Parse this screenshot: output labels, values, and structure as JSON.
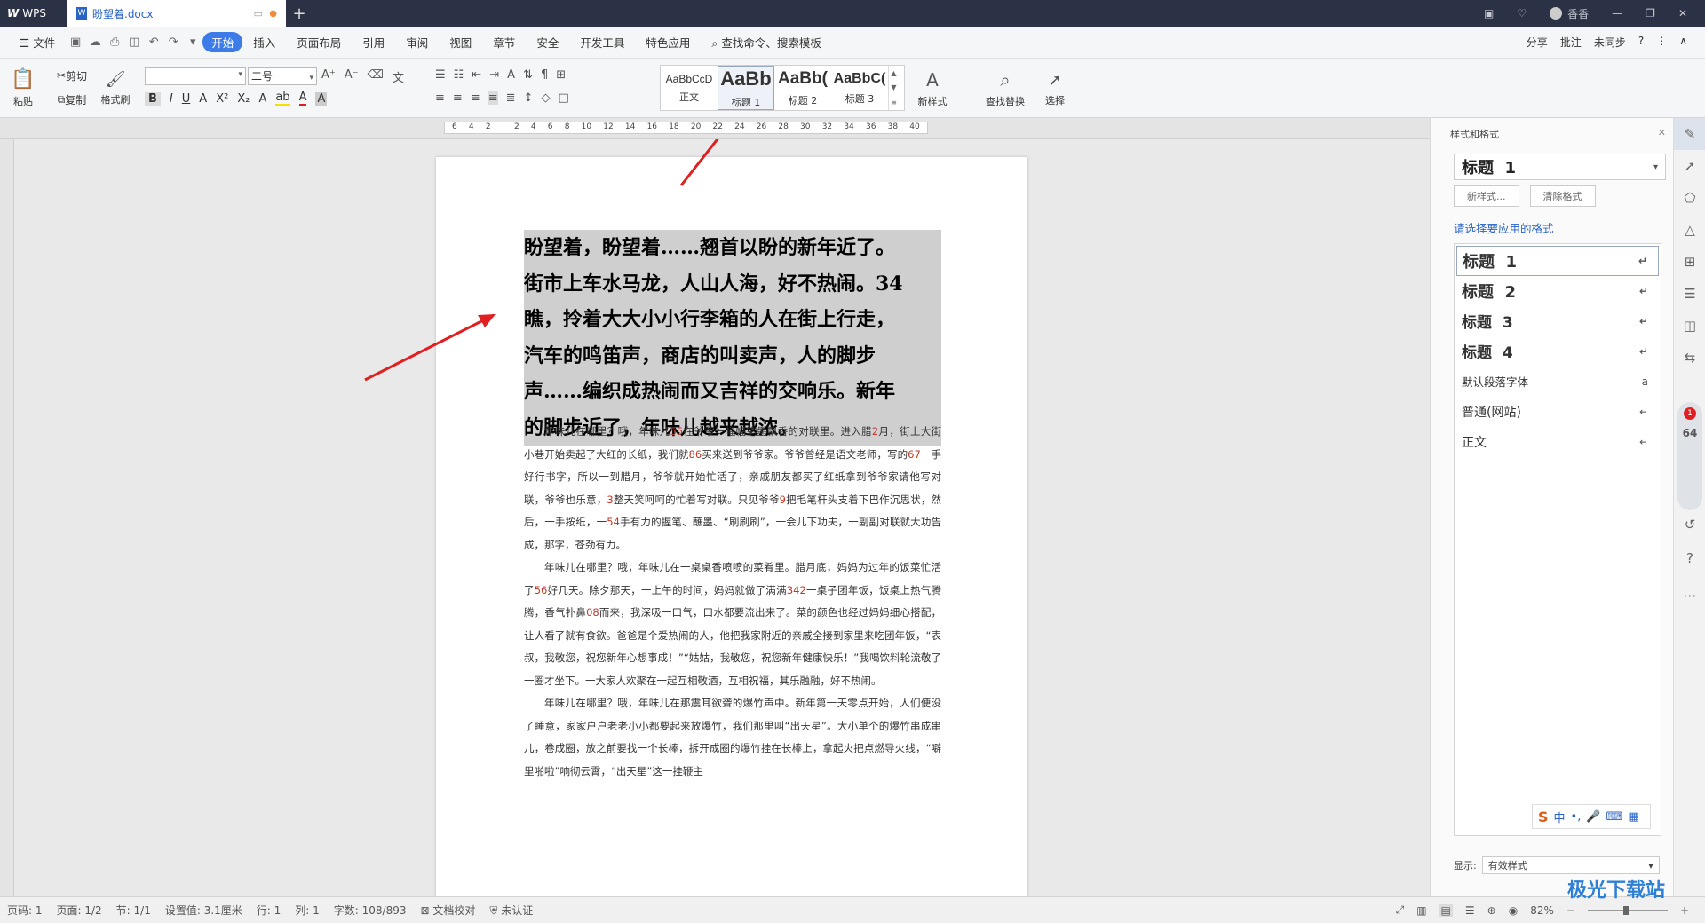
{
  "titlebar": {
    "app": "WPS",
    "doc_tab": "盼望着.docx",
    "user": "香香"
  },
  "menu": {
    "file": "文件",
    "items": [
      "开始",
      "插入",
      "页面布局",
      "引用",
      "审阅",
      "视图",
      "章节",
      "安全",
      "开发工具",
      "特色应用"
    ],
    "search": "查找命令、搜索模板",
    "right": [
      "分享",
      "批注",
      "未同步"
    ]
  },
  "ribbon": {
    "paste": "粘贴",
    "cut": "剪切",
    "copy": "复制",
    "format_painter": "格式刷",
    "font_name": "",
    "font_size": "二号",
    "styles": [
      {
        "preview": "AaBbCcD",
        "label": "正文"
      },
      {
        "preview": "AaBb",
        "label": "标题 1"
      },
      {
        "preview": "AaBb(",
        "label": "标题 2"
      },
      {
        "preview": "AaBbC(",
        "label": "标题 3"
      }
    ],
    "new_style": "新样式",
    "find_replace": "查找替换",
    "select": "选择"
  },
  "ruler": {
    "ticks": [
      "6",
      "4",
      "2",
      "",
      "2",
      "4",
      "6",
      "8",
      "10",
      "12",
      "14",
      "16",
      "18",
      "20",
      "22",
      "24",
      "26",
      "28",
      "30",
      "32",
      "34",
      "36",
      "38",
      "40"
    ]
  },
  "document": {
    "heading_lines": [
      "盼望着，盼望着……翘首以盼的新年近了。",
      "街市上车水马龙，人山人海，好不热闹。34",
      "瞧，拎着大大小小行李箱的人在街上行走，",
      "汽车的鸣笛声，商店的叫卖声，人的脚步",
      "声……编织成热闹而又吉祥的交响乐。新年",
      "的脚步近了，年味儿越来越浓。"
    ],
    "p1": {
      "a": "年味儿在哪里？哦，年味儿",
      "n1": "55",
      "b": "在爷爷一幅幅笔墨飘香的对联里。进入腊",
      "n2": "2",
      "c": "月，街上大街小巷开始卖起了大红的长纸，我们就",
      "n3": "86",
      "d": "买来送到爷爷家。爷爷曾经是语文老师，写的",
      "n4": "67",
      "e": "一手好行书字，所以一到腊月，爷爷就开始忙活了，亲戚朋友都买了红纸拿到爷爷家请他写对联，爷爷也乐意，",
      "n5": "3",
      "f": "整天笑呵呵的忙着写对联。只见爷爷",
      "n6": "9",
      "g": "把毛笔杆头支着下巴作沉思状，然后，一手按纸，一",
      "n7": "54",
      "h": "手有力的握笔、蘸墨、“刷刷刷”，一会儿下功夫，一副副对联就大功告成，那字，苍劲有力。"
    },
    "p2": {
      "a": "年味儿在哪里？哦，年味儿在一桌桌香喷喷的菜肴里。腊月底，妈妈为过年的饭菜忙活了",
      "n1": "56",
      "b": "好几天。除夕那天，一上午的时间，妈妈就做了满满",
      "n2": "342",
      "c": "一桌子团年饭，饭桌上热气腾腾，香气扑鼻",
      "n3": "08",
      "d": "而来，我深吸一口气，口水都要流出来了。菜的颜色也经过妈妈细心搭配，让人看了就有食欲。爸爸是个爱热闹的人，他把我家附近的亲戚全接到家里来吃团年饭，“表叔，我敬您，祝您新年心想事成！”“姑姑，我敬您，祝您新年健康快乐！”我喝饮料轮流敬了一圈才坐下。一大家人欢聚在一起互相敬酒，互相祝福，其乐融融，好不热闹。"
    },
    "p3": "年味儿在哪里？哦，年味儿在那震耳欲聋的爆竹声中。新年第一天零点开始，人们便没了睡意，家家户户老老小小都要起来放爆竹，我们那里叫“出天星”。大小单个的爆竹串成串儿，卷成圈，放之前要找一个长棒，拆开成圈的爆竹挂在长棒上，拿起火把点燃导火线，“噼里啪啦”响彻云霄，“出天星”这一挂鞭主"
  },
  "sidebar": {
    "title": "样式和格式",
    "current": "标题  1",
    "new_style_btn": "新样式...",
    "clear_btn": "清除格式",
    "apply_label": "请选择要应用的格式",
    "styles": [
      {
        "name": "标题  1",
        "mark": "↵"
      },
      {
        "name": "标题  2",
        "mark": "↵"
      },
      {
        "name": "标题  3",
        "mark": "↵"
      },
      {
        "name": "标题  4",
        "mark": "↵"
      },
      {
        "name": "默认段落字体",
        "mark": "a"
      },
      {
        "name": "普通(网站)",
        "mark": "↵"
      },
      {
        "name": "正文",
        "mark": "↵"
      }
    ],
    "show_label": "显示:",
    "show_value": "有效样式"
  },
  "status": {
    "page_num": "页码: 1",
    "pages": "页面: 1/2",
    "section": "节: 1/1",
    "setting": "设置值: 3.1厘米",
    "row": "行: 1",
    "col": "列: 1",
    "words": "字数: 108/893",
    "proof": "文档校对",
    "cert": "未认证",
    "zoom": "82%"
  },
  "widget": {
    "value": "64",
    "badge": "1"
  },
  "watermark": "极光下载站",
  "colors": {
    "accent": "#3c7be8",
    "arrow": "#e02020",
    "selection": "#cfcfcf"
  }
}
